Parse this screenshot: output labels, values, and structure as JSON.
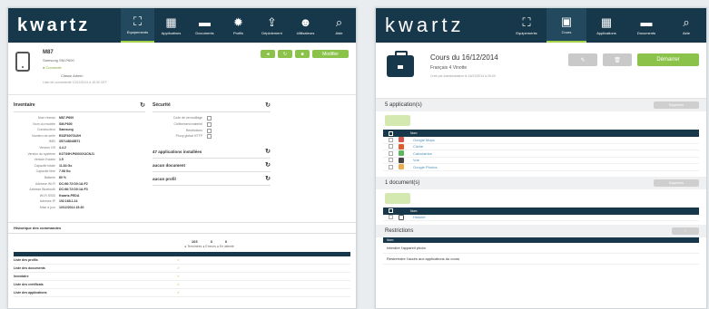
{
  "left": {
    "brand_main": "kwartz",
    "nav": [
      {
        "icon": "network-icon",
        "glyph": "⛶",
        "label": "Equipements",
        "active": true
      },
      {
        "icon": "grid-icon",
        "glyph": "▦",
        "label": "Applications",
        "active": false
      },
      {
        "icon": "folder-icon",
        "glyph": "▬",
        "label": "Documents",
        "active": false
      },
      {
        "icon": "gear-icon",
        "glyph": "✹",
        "label": "Profils",
        "active": false
      },
      {
        "icon": "upload-icon",
        "glyph": "⇪",
        "label": "Déploiement",
        "active": false
      },
      {
        "icon": "users-icon",
        "glyph": "☻",
        "label": "Utilisateurs",
        "active": false
      },
      {
        "icon": "search-icon",
        "glyph": "⌕",
        "label": "Aide",
        "active": false
      }
    ],
    "device": {
      "name": "M87",
      "model": "Samsung SM-P600",
      "status": "Connecté",
      "meta": "Classe   Admin",
      "sub": "Liste de connectivité 10/12/2014 à 15:30 CET",
      "btn_main": "Modifier"
    },
    "inventory": {
      "title": "Inventaire",
      "rows": [
        {
          "k": "Nom réseau",
          "v": "M87-P600"
        },
        {
          "k": "Nom du modèle",
          "v": "SM-P600"
        },
        {
          "k": "Constructeur",
          "v": "Samsung"
        },
        {
          "k": "Numéro de série",
          "v": "R32F300TAGH"
        },
        {
          "k": "IMEI",
          "v": "357148048571"
        },
        {
          "k": "Version OS",
          "v": "4.4.2"
        },
        {
          "k": "Version du système",
          "v": "KOT49H.P600XXUCNJ1"
        },
        {
          "k": "Version Kwartz",
          "v": "1.5"
        },
        {
          "k": "Capacité totale",
          "v": "11.84 Go"
        },
        {
          "k": "Capacité libre",
          "v": "7.98 Go"
        },
        {
          "k": "Batterie",
          "v": "80 %"
        },
        {
          "k": "Adresse Wi-Fi",
          "v": "DC:66:72:D0:1A:F2"
        },
        {
          "k": "Adresse Bluetooth",
          "v": "DC:66:72:D0:1A:F3"
        },
        {
          "k": "Wi-Fi SSID",
          "v": "Kwartz-PEDA"
        },
        {
          "k": "Adresse IP",
          "v": "192.168.1.24"
        },
        {
          "k": "Mise à jour",
          "v": "10/12/2014 15:30"
        }
      ]
    },
    "security": {
      "title": "Sécurité",
      "rows": [
        "Code de verrouillage",
        "Chiffrement matériel",
        "Restrictions",
        "Proxy global HTTP"
      ]
    },
    "lists": [
      {
        "label": "47 applications installées"
      },
      {
        "label": "aucun document"
      },
      {
        "label": "aucun profil"
      }
    ],
    "history": {
      "title": "Historique des commandes",
      "stats": [
        {
          "num": "103"
        },
        {
          "num": "3"
        },
        {
          "num": "0"
        }
      ],
      "legend": "● Terminées ● Erreurs ● En attente",
      "rows": [
        {
          "name": "Liste des profils",
          "status": "✓"
        },
        {
          "name": "Liste des documents",
          "status": "✓"
        },
        {
          "name": "Inventaire",
          "status": "✓"
        },
        {
          "name": "Liste des certificats",
          "status": "✓"
        },
        {
          "name": "Liste des applications",
          "status": "✓"
        }
      ]
    }
  },
  "right": {
    "brand_main": "kwartz",
    "nav": [
      {
        "icon": "network-icon",
        "glyph": "⛶",
        "label": "Equipements",
        "active": false
      },
      {
        "icon": "briefcase-icon",
        "glyph": "▣",
        "label": "Cours",
        "active": true
      },
      {
        "icon": "grid-icon",
        "glyph": "▦",
        "label": "Applications",
        "active": false
      },
      {
        "icon": "folder-icon",
        "glyph": "▬",
        "label": "Documents",
        "active": false
      },
      {
        "icon": "search-icon",
        "glyph": "⌕",
        "label": "Aide",
        "active": false
      }
    ],
    "course": {
      "title": "Cours du 16/12/2014",
      "subtitle": "Français 4 Vinotte",
      "meta": "Créé par Administrateur le 16/12/2014 à 09:00",
      "btn_edit": "✎",
      "btn_delete": "🗑",
      "btn_start": "Démarrer"
    },
    "apps_section": {
      "title": "5 application(s)",
      "pill": "Supprimer",
      "table_header": "Nom",
      "items": [
        {
          "name": "Google Maps",
          "color": "#d9534f"
        },
        {
          "name": "Cliché",
          "color": "#e05a2a"
        },
        {
          "name": "Calculatrice",
          "color": "#5cb85c"
        },
        {
          "name": "Vue",
          "color": "#444444"
        },
        {
          "name": "Google Photos",
          "color": "#f0ad4e"
        }
      ]
    },
    "docs_section": {
      "title": "1 document(s)",
      "pill": "Supprimer",
      "table_header": "Nom",
      "items": [
        {
          "name": "Histoire"
        }
      ]
    },
    "restrictions": {
      "title": "Restrictions",
      "pill": "+",
      "table_header": "Nom",
      "rows": [
        "Interdire l'appareil photo",
        "Restreindre l'accès aux applications du cours"
      ]
    }
  }
}
